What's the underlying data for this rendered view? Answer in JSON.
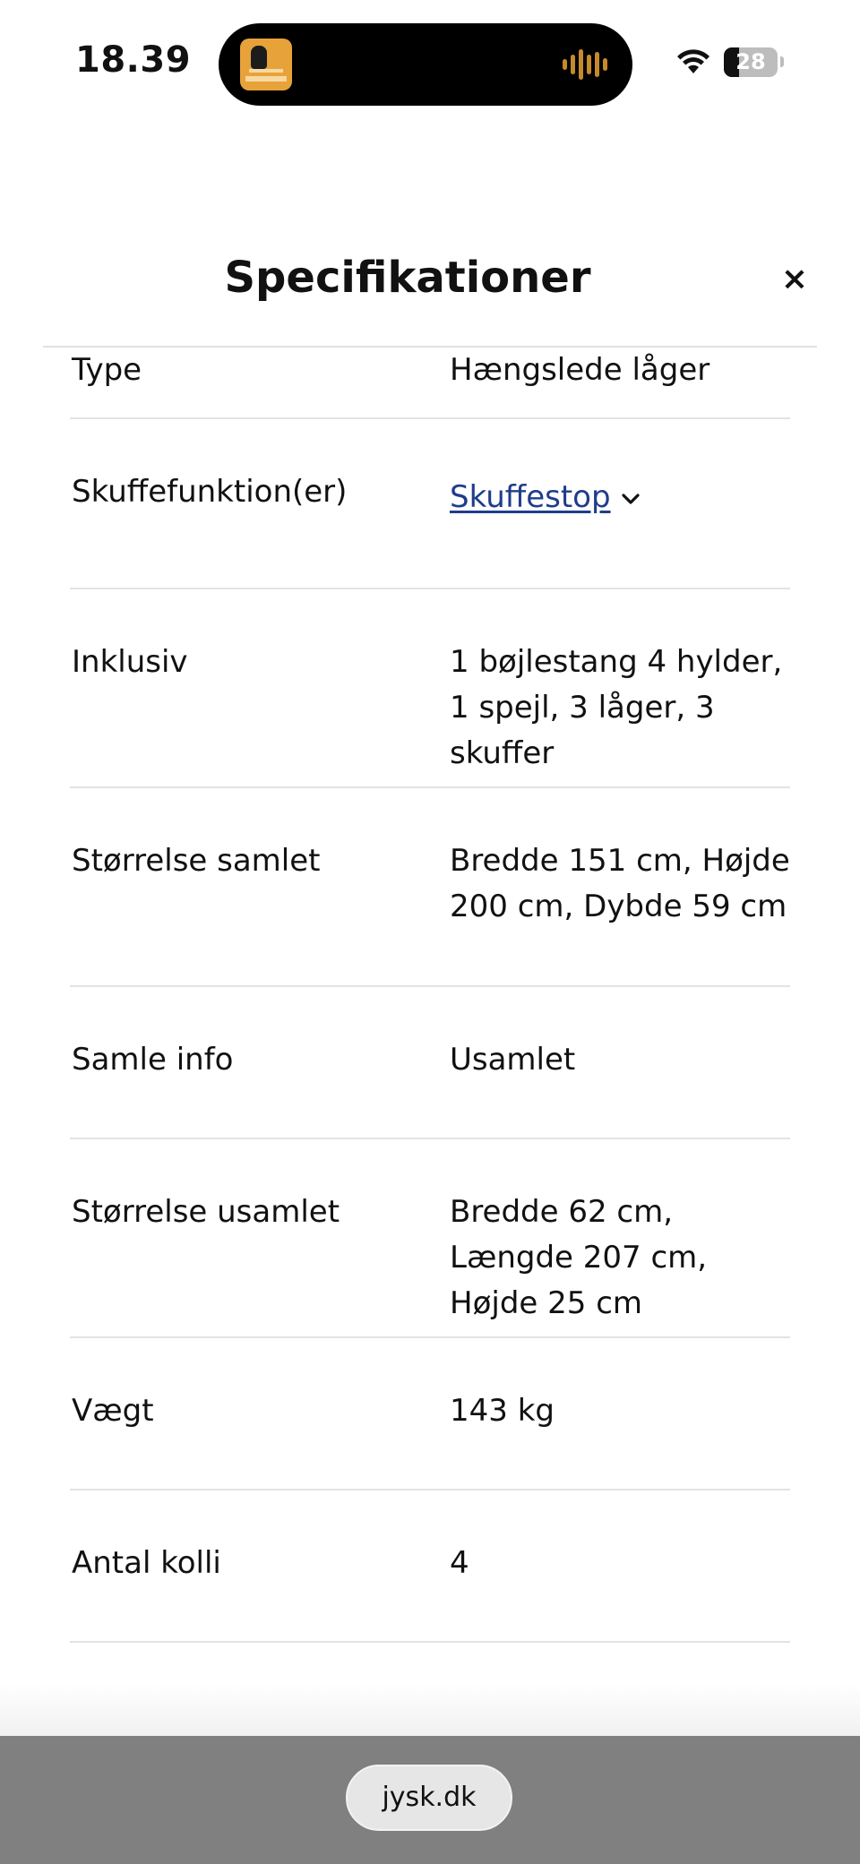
{
  "status_bar": {
    "time": "18.39",
    "battery_level": "28",
    "battery_fraction": 0.28,
    "wifi_icon": "wifi-icon",
    "now_playing_icon": "podcast-artwork-icon",
    "waveform_icon": "audio-waveform-icon",
    "accent_color": "#c58a2b"
  },
  "modal": {
    "title": "Specifikationer",
    "close_label": "×"
  },
  "specs": [
    {
      "label": "Type",
      "value": "Hængslede låger",
      "partial": true
    },
    {
      "label": "Skuffefunktion(er)",
      "value": "Skuffestop",
      "link": true,
      "icon": "chevron-down-icon"
    },
    {
      "label": "Inklusiv",
      "value": "1 bøjlestang 4 hylder, 1 spejl, 3 låger, 3 skuffer"
    },
    {
      "label": "Størrelse samlet",
      "value": "Bredde 151 cm, Højde 200 cm, Dybde 59 cm"
    },
    {
      "label": "Samle info",
      "value": "Usamlet"
    },
    {
      "label": "Størrelse usamlet",
      "value": "Bredde 62 cm, Længde 207 cm, Højde 25 cm"
    },
    {
      "label": "Vægt",
      "value": "143 kg"
    },
    {
      "label": "Antal kolli",
      "value": "4"
    }
  ],
  "browser": {
    "url": "jysk.dk",
    "link_color": "#1f3d8c"
  }
}
